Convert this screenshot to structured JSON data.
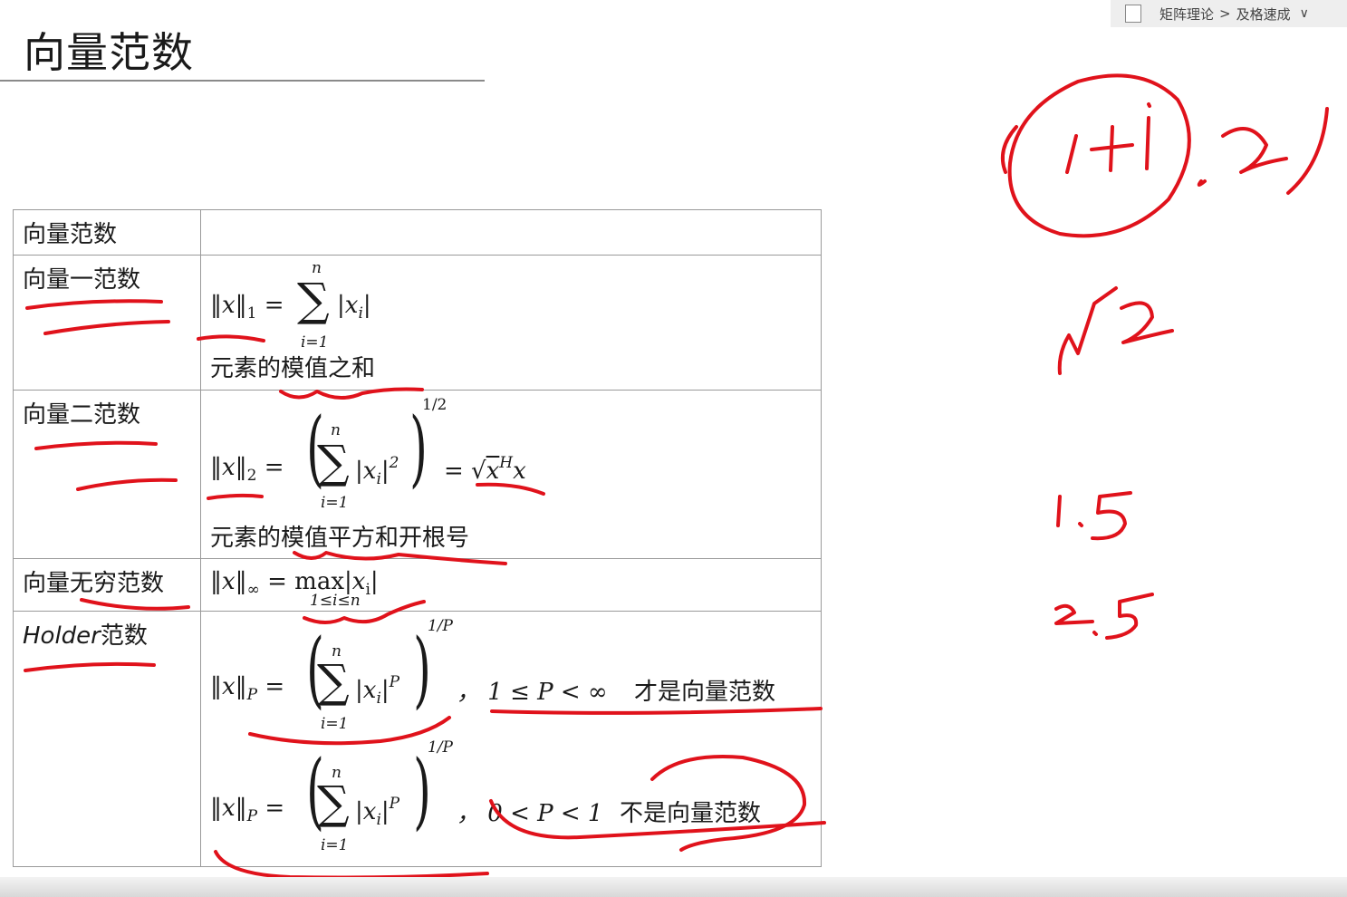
{
  "breadcrumb": {
    "root": "矩阵理论",
    "separator": ">",
    "current": "及格速成"
  },
  "title": "向量范数",
  "table": {
    "header": {
      "name": "向量范数",
      "value": ""
    },
    "rows": [
      {
        "name": "向量一范数",
        "lhs": "‖x‖",
        "lhs_sub": "1",
        "eq": "=",
        "sum_top": "n",
        "sum_bottom": "i=1",
        "term": "|x",
        "term_sub": "i",
        "term_end": "|",
        "caption": "元素的模值之和"
      },
      {
        "name": "向量二范数",
        "lhs": "‖x‖",
        "lhs_sub": "2",
        "eq": "=",
        "sum_top": "n",
        "sum_bottom": "i=1",
        "term": "|x",
        "term_sub": "i",
        "term_end": "|",
        "term_sup": "2",
        "exponent": "1/2",
        "rhs": "= √",
        "rhs_x": "x",
        "rhs_sup": "H",
        "rhs_x2": "x",
        "caption": "元素的模值平方和开根号"
      },
      {
        "name": "向量无穷范数",
        "lhs": "‖x‖",
        "lhs_sub": "∞",
        "eq": "=",
        "op": "max",
        "op_bottom": "1≤i≤n",
        "term": "|x",
        "term_sub": "i",
        "term_end": "|"
      },
      {
        "name_latin": "Holder",
        "name": "范数",
        "lhs": "‖x‖",
        "lhs_sub": "P",
        "eq": "=",
        "sum_top": "n",
        "sum_bottom": "i=1",
        "term": "|x",
        "term_sub": "i",
        "term_end": "|",
        "term_sup": "P",
        "exponent": "1/P",
        "cond1": "，  1 ≤ P < ∞",
        "note1": "才是向量范数",
        "cond2": "，  0 < P < 1",
        "note2": "不是向量范数"
      }
    ]
  },
  "handwriting": {
    "pair": "(1+i, 2)",
    "root": "√2",
    "v1": "1.5",
    "v2": "2.5"
  },
  "colors": {
    "ink": "#e0121b",
    "grid": "#9a9a9a"
  }
}
